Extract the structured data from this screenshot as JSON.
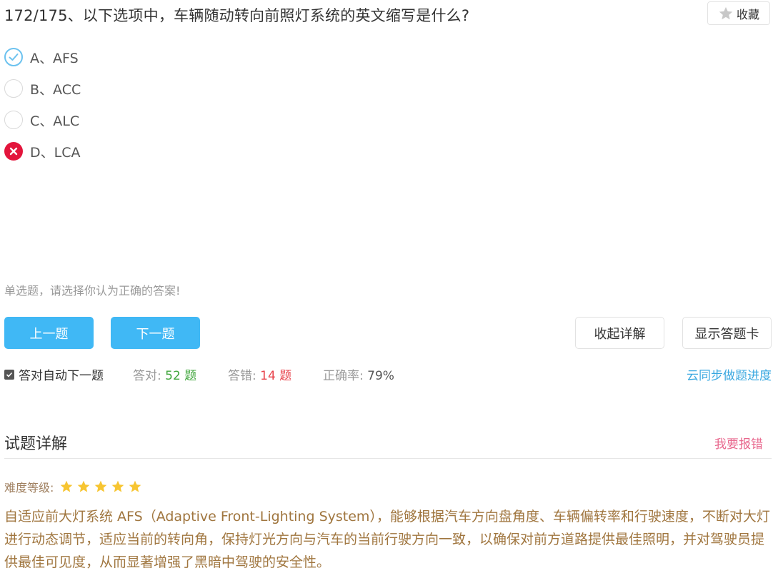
{
  "question": {
    "title": "172/175、以下选项中，车辆随动转向前照灯系统的英文缩写是什么?",
    "options": [
      {
        "label": "A、AFS",
        "state": "correct"
      },
      {
        "label": "B、ACC",
        "state": "unselected"
      },
      {
        "label": "C、ALC",
        "state": "unselected"
      },
      {
        "label": "D、LCA",
        "state": "wrong"
      }
    ],
    "hint": "单选题，请选择你认为正确的答案!"
  },
  "favorite": {
    "label": "收藏",
    "icon": "star-icon"
  },
  "buttons": {
    "prev": "上一题",
    "next": "下一题",
    "collapse": "收起详解",
    "answer_card": "显示答题卡"
  },
  "stats": {
    "auto_next": "答对自动下一题",
    "correct_label": "答对:",
    "correct_value": "52 题",
    "wrong_label": "答错:",
    "wrong_value": "14 题",
    "rate_label": "正确率:",
    "rate_value": "79%",
    "sync": "云同步做题进度"
  },
  "explain": {
    "title": "试题详解",
    "report": "我要报错",
    "difficulty_label": "难度等级:",
    "difficulty_stars": 5,
    "text": "自适应前大灯系统 AFS（Adaptive Front-Lighting System），能够根据汽车方向盘角度、车辆偏转率和行驶速度，不断对大灯进行动态调节，适应当前的转向角，保持灯光方向与汽车的当前行驶方向一致，以确保对前方道路提供最佳照明，并对驾驶员提供最佳可见度，从而显著增强了黑暗中驾驶的安全性。"
  },
  "colors": {
    "primary": "#40b8f5",
    "correct": "#6cc2ef",
    "wrong": "#e3153c",
    "explain_text": "#a0763f",
    "star": "#f7c531"
  }
}
